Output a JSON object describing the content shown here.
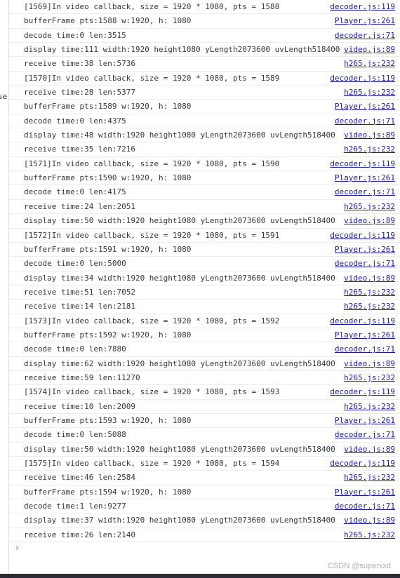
{
  "gutter_fragment": "se",
  "logs": [
    {
      "msg": "[1569]In video callback, size = 1920 * 1080, pts = 1588",
      "src": "decoder.js:119"
    },
    {
      "msg": "bufferFrame pts:1588 w:1920, h: 1080",
      "src": "Player.js:261"
    },
    {
      "msg": "decode time:0 len:3515",
      "src": "decoder.js:71"
    },
    {
      "msg": "display time:111 width:1920 height1080 yLength2073600 uvLength518400",
      "src": "video.js:89"
    },
    {
      "msg": "receive time:38 len:5736",
      "src": "h265.js:232"
    },
    {
      "msg": "[1570]In video callback, size = 1920 * 1080, pts = 1589",
      "src": "decoder.js:119"
    },
    {
      "msg": "receive time:28 len:5377",
      "src": "h265.js:232"
    },
    {
      "msg": "bufferFrame pts:1589 w:1920, h: 1080",
      "src": "Player.js:261"
    },
    {
      "msg": "decode time:0 len:4375",
      "src": "decoder.js:71"
    },
    {
      "msg": "display time:48 width:1920 height1080 yLength2073600 uvLength518400",
      "src": "video.js:89"
    },
    {
      "msg": "receive time:35 len:7216",
      "src": "h265.js:232"
    },
    {
      "msg": "[1571]In video callback, size = 1920 * 1080, pts = 1590",
      "src": "decoder.js:119"
    },
    {
      "msg": "bufferFrame pts:1590 w:1920, h: 1080",
      "src": "Player.js:261"
    },
    {
      "msg": "decode time:0 len:4175",
      "src": "decoder.js:71"
    },
    {
      "msg": "receive time:24 len:2051",
      "src": "h265.js:232"
    },
    {
      "msg": "display time:50 width:1920 height1080 yLength2073600 uvLength518400",
      "src": "video.js:89"
    },
    {
      "msg": "[1572]In video callback, size = 1920 * 1080, pts = 1591",
      "src": "decoder.js:119"
    },
    {
      "msg": "bufferFrame pts:1591 w:1920, h: 1080",
      "src": "Player.js:261"
    },
    {
      "msg": "decode time:0 len:5000",
      "src": "decoder.js:71"
    },
    {
      "msg": "display time:34 width:1920 height1080 yLength2073600 uvLength518400",
      "src": "video.js:89"
    },
    {
      "msg": "receive time:51 len:7052",
      "src": "h265.js:232"
    },
    {
      "msg": "receive time:14 len:2181",
      "src": "h265.js:232"
    },
    {
      "msg": "[1573]In video callback, size = 1920 * 1080, pts = 1592",
      "src": "decoder.js:119"
    },
    {
      "msg": "bufferFrame pts:1592 w:1920, h: 1080",
      "src": "Player.js:261"
    },
    {
      "msg": "decode time:0 len:7880",
      "src": "decoder.js:71"
    },
    {
      "msg": "display time:62 width:1920 height1080 yLength2073600 uvLength518400",
      "src": "video.js:89"
    },
    {
      "msg": "receive time:59 len:11270",
      "src": "h265.js:232"
    },
    {
      "msg": "[1574]In video callback, size = 1920 * 1080, pts = 1593",
      "src": "decoder.js:119"
    },
    {
      "msg": "receive time:10 len:2009",
      "src": "h265.js:232"
    },
    {
      "msg": "bufferFrame pts:1593 w:1920, h: 1080",
      "src": "Player.js:261"
    },
    {
      "msg": "decode time:0 len:5088",
      "src": "decoder.js:71"
    },
    {
      "msg": "display time:50 width:1920 height1080 yLength2073600 uvLength518400",
      "src": "video.js:89"
    },
    {
      "msg": "[1575]In video callback, size = 1920 * 1080, pts = 1594",
      "src": "decoder.js:119"
    },
    {
      "msg": "receive time:46 len:2584",
      "src": "h265.js:232"
    },
    {
      "msg": "bufferFrame pts:1594 w:1920, h: 1080",
      "src": "Player.js:261"
    },
    {
      "msg": "decode time:1 len:9277",
      "src": "decoder.js:71"
    },
    {
      "msg": "display time:37 width:1920 height1080 yLength2073600 uvLength518400",
      "src": "video.js:89"
    },
    {
      "msg": "receive time:26 len:2140",
      "src": "h265.js:232"
    }
  ],
  "prompt_glyph": "›",
  "watermark": "CSDN @superxxd",
  "colors": {
    "text": "#303942",
    "link": "#1a1aa6",
    "prompt": "#3b8ad8",
    "divider": "#ececec",
    "bottom_bar": "#2b2d33"
  }
}
